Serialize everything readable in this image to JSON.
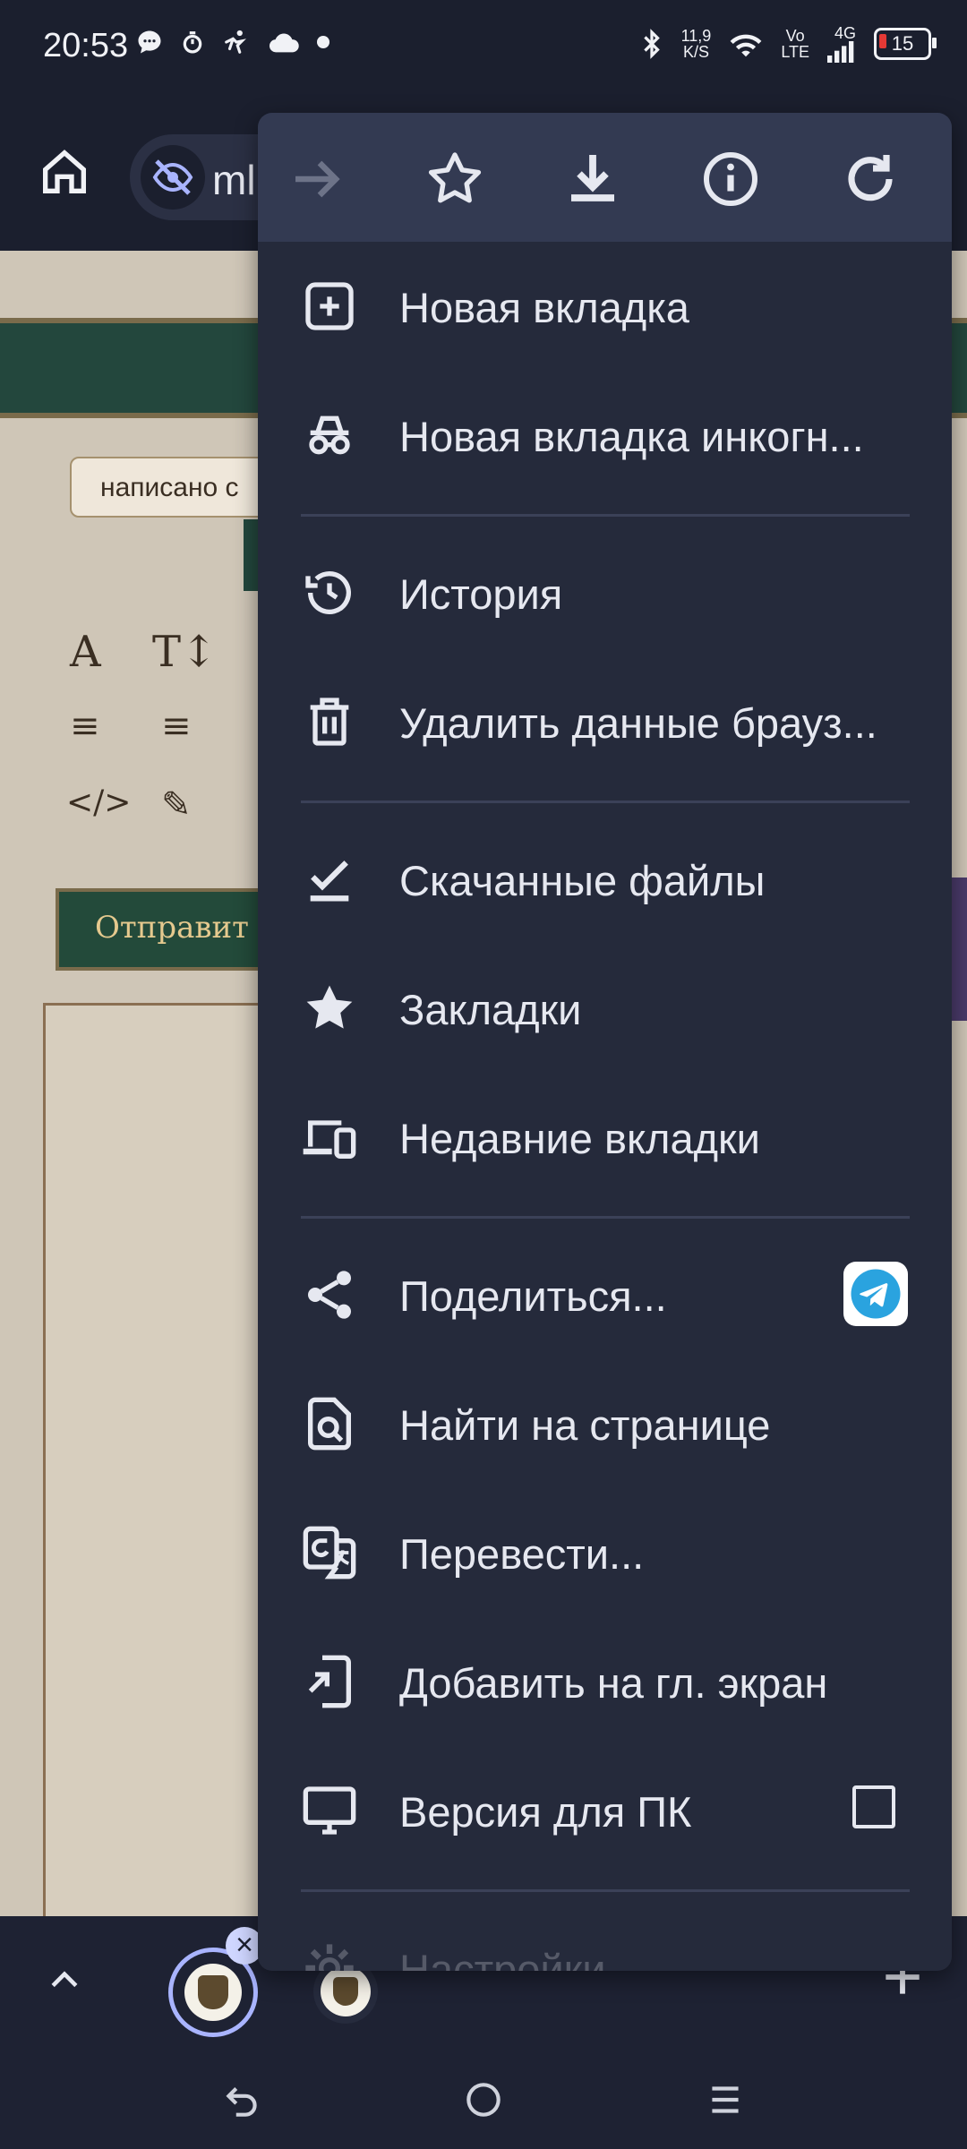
{
  "status_bar": {
    "time": "20:53",
    "net_speed_value": "11,9",
    "net_speed_unit": "K/S",
    "volte_top": "Vo",
    "volte_bottom": "LTE",
    "network": "4G",
    "battery": "15",
    "icons_left": [
      "chat-icon",
      "timer-icon",
      "activity-icon",
      "cloud-icon",
      "dot-icon"
    ],
    "icons_right": [
      "bluetooth-icon",
      "wifi-icon",
      "signal-icon",
      "battery-icon"
    ]
  },
  "toolbar": {
    "url_visible": "ml"
  },
  "page": {
    "pill_text": "написано с",
    "send_button": "Отправит"
  },
  "menu": {
    "top_actions": [
      "forward-icon",
      "bookmark-star-icon",
      "download-icon",
      "info-icon",
      "reload-icon"
    ],
    "items": [
      {
        "label": "Новая вкладка",
        "icon": "new-tab-icon"
      },
      {
        "label": "Новая вкладка инкогн...",
        "icon": "incognito-icon"
      },
      {
        "label": "История",
        "icon": "history-icon"
      },
      {
        "label": "Удалить данные брауз...",
        "icon": "trash-icon"
      },
      {
        "label": "Скачанные файлы",
        "icon": "downloads-check-icon"
      },
      {
        "label": "Закладки",
        "icon": "star-icon"
      },
      {
        "label": "Недавние вкладки",
        "icon": "devices-icon"
      },
      {
        "label": "Поделиться...",
        "icon": "share-icon"
      },
      {
        "label": "Найти на странице",
        "icon": "find-in-page-icon"
      },
      {
        "label": "Перевести...",
        "icon": "translate-icon"
      },
      {
        "label": "Добавить на гл. экран",
        "icon": "add-to-home-icon"
      },
      {
        "label": "Версия для ПК",
        "icon": "desktop-icon"
      },
      {
        "label": "Настройки",
        "icon": "settings-icon"
      }
    ]
  }
}
